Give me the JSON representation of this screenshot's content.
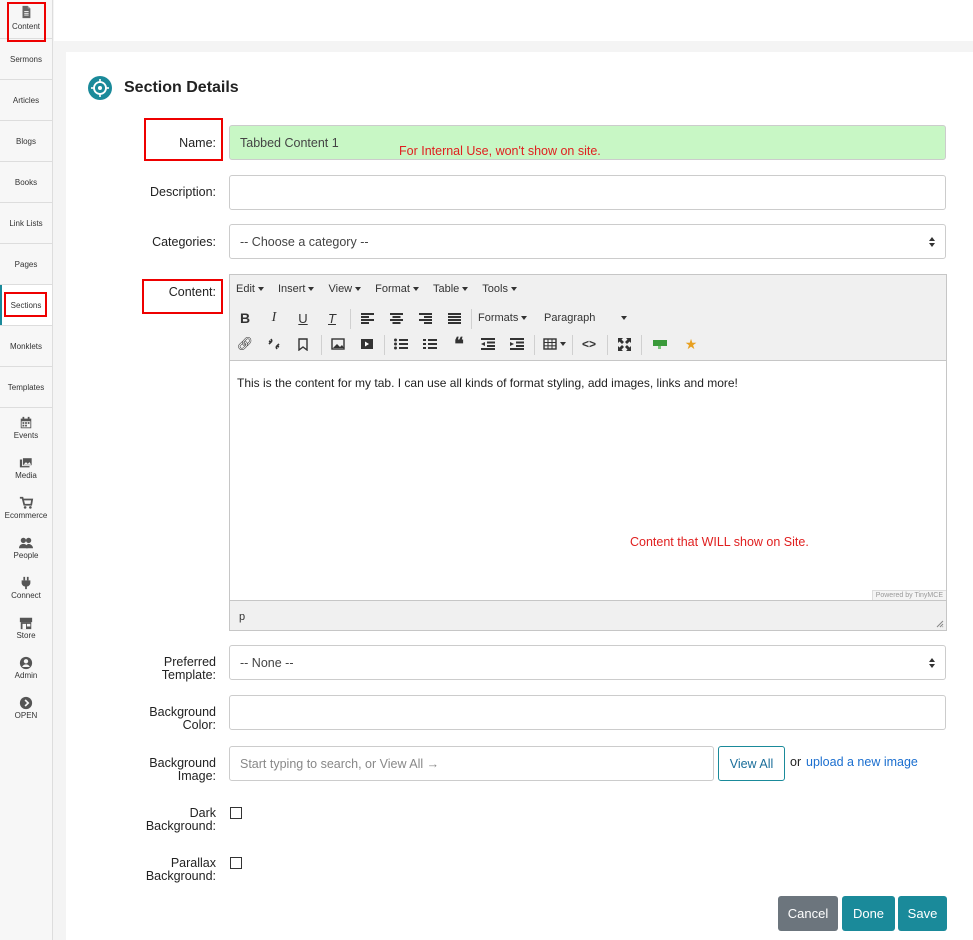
{
  "sidebar": {
    "items": [
      {
        "label": "Content",
        "icon": "document-icon"
      },
      {
        "label": "Sermons"
      },
      {
        "label": "Articles"
      },
      {
        "label": "Blogs"
      },
      {
        "label": "Books"
      },
      {
        "label": "Link Lists"
      },
      {
        "label": "Pages"
      },
      {
        "label": "Sections"
      },
      {
        "label": "Monklets"
      },
      {
        "label": "Templates"
      },
      {
        "label": "Events",
        "icon": "calendar-icon"
      },
      {
        "label": "Media",
        "icon": "images-icon"
      },
      {
        "label": "Ecommerce",
        "icon": "cart-icon"
      },
      {
        "label": "People",
        "icon": "people-icon"
      },
      {
        "label": "Connect",
        "icon": "plug-icon"
      },
      {
        "label": "Store",
        "icon": "store-icon"
      },
      {
        "label": "Admin",
        "icon": "user-icon"
      },
      {
        "label": "OPEN",
        "icon": "chevron-right-circle-icon"
      }
    ]
  },
  "page": {
    "title": "Section Details"
  },
  "form": {
    "name_label": "Name:",
    "name_value": "Tabbed Content 1",
    "name_annotation": "For Internal Use, won't show on site.",
    "description_label": "Description:",
    "description_value": "",
    "categories_label": "Categories:",
    "categories_value": "-- Choose a category --",
    "content_label": "Content:",
    "preferred_template_label_1": "Preferred",
    "preferred_template_label_2": "Template:",
    "preferred_template_value": "-- None --",
    "bg_color_label_1": "Background",
    "bg_color_label_2": "Color:",
    "bg_color_value": "",
    "bg_image_label_1": "Background",
    "bg_image_label_2": "Image:",
    "bg_image_placeholder": "Start typing to search, or View All →",
    "view_all_label": "View All",
    "or_text": "or",
    "upload_link": "upload a new image",
    "dark_bg_label_1": "Dark",
    "dark_bg_label_2": "Background:",
    "parallax_label_1": "Parallax",
    "parallax_label_2": "Background:"
  },
  "editor": {
    "menus": [
      "Edit",
      "Insert",
      "View",
      "Format",
      "Table",
      "Tools"
    ],
    "formats_label": "Formats",
    "paragraph_label": "Paragraph",
    "body_text": "This is the content for my tab. I can use all kinds of format styling, add images, links and more!",
    "annotation": "Content that WILL show on Site.",
    "powered_by": "Powered by TinyMCE",
    "status_path": "p"
  },
  "actions": {
    "cancel": "Cancel",
    "done": "Done",
    "save": "Save"
  },
  "colors": {
    "accent": "#1a8a9a",
    "highlight": "#e00000",
    "name_field_bg": "#c8f7c5",
    "cancel_bg": "#6c757d"
  }
}
